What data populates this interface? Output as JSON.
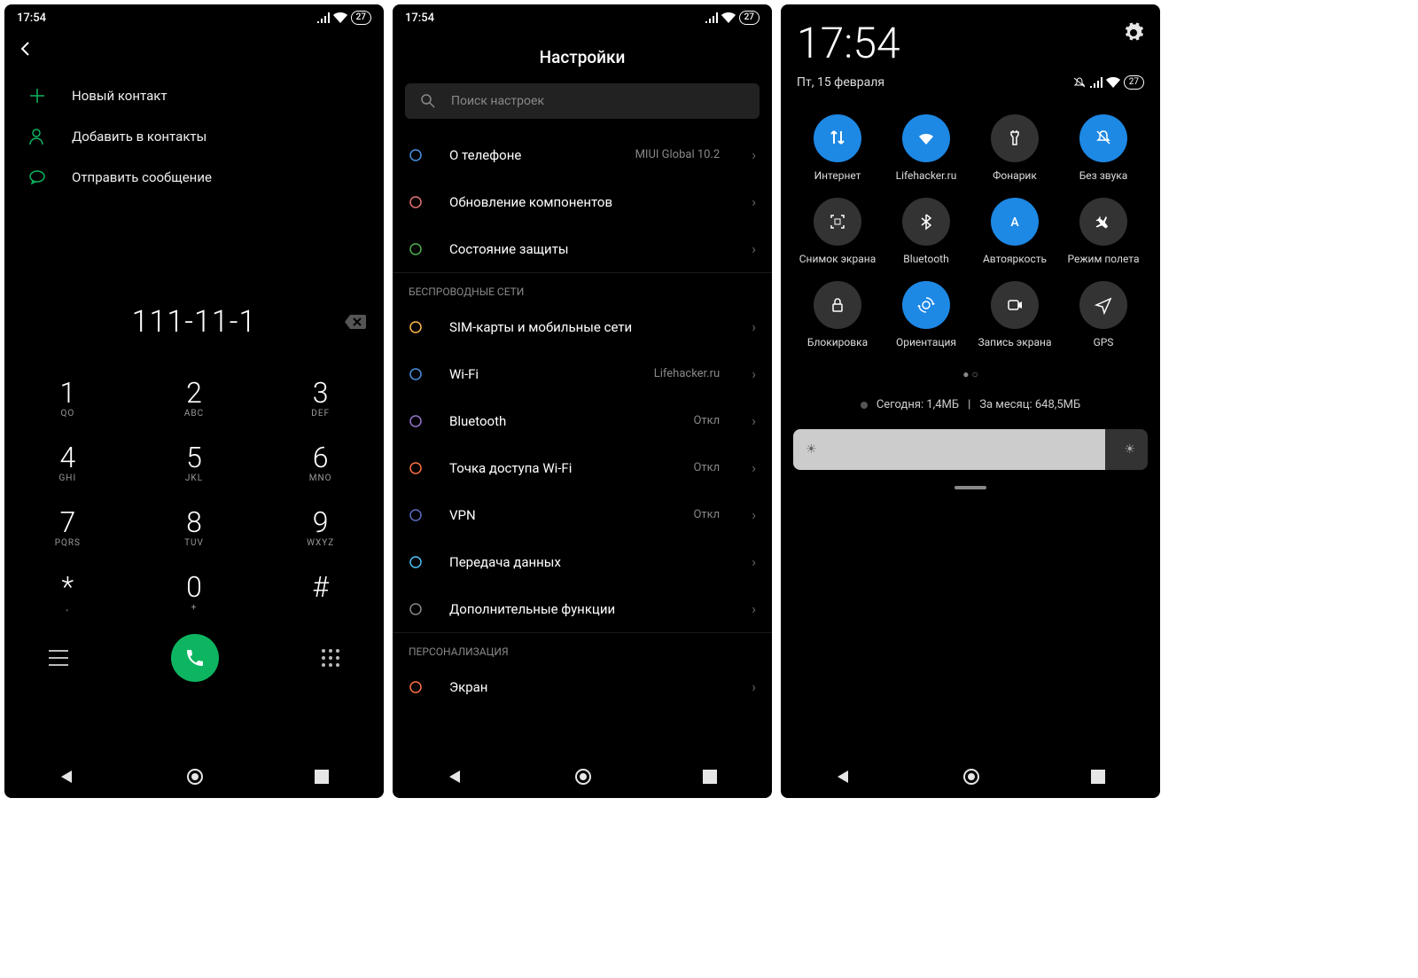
{
  "status": {
    "time": "17:54",
    "battery": "27"
  },
  "dialer": {
    "actions": [
      {
        "label": "Новый контакт",
        "icon": "plus",
        "color": "#0db561"
      },
      {
        "label": "Добавить в контакты",
        "icon": "person",
        "color": "#0db561"
      },
      {
        "label": "Отправить сообщение",
        "icon": "message",
        "color": "#0db561"
      }
    ],
    "number": "111-11-1",
    "keys": [
      [
        {
          "d": "1",
          "l": "QO"
        },
        {
          "d": "2",
          "l": "ABC"
        },
        {
          "d": "3",
          "l": "DEF"
        }
      ],
      [
        {
          "d": "4",
          "l": "GHI"
        },
        {
          "d": "5",
          "l": "JKL"
        },
        {
          "d": "6",
          "l": "MNO"
        }
      ],
      [
        {
          "d": "7",
          "l": "PQRS"
        },
        {
          "d": "8",
          "l": "TUV"
        },
        {
          "d": "9",
          "l": "WXYZ"
        }
      ],
      [
        {
          "d": "*",
          "l": ","
        },
        {
          "d": "0",
          "l": "+"
        },
        {
          "d": "#",
          "l": ""
        }
      ]
    ]
  },
  "settings": {
    "title": "Настройки",
    "search_placeholder": "Поиск настроек",
    "top_items": [
      {
        "label": "О телефоне",
        "value": "MIUI Global 10.2",
        "color": "#4a90e2"
      },
      {
        "label": "Обновление компонентов",
        "value": "",
        "color": "#e57373"
      },
      {
        "label": "Состояние защиты",
        "value": "",
        "color": "#4caf50"
      }
    ],
    "section1_title": "БЕСПРОВОДНЫЕ СЕТИ",
    "section1_items": [
      {
        "label": "SIM-карты и мобильные сети",
        "value": "",
        "color": "#ffb74d"
      },
      {
        "label": "Wi-Fi",
        "value": "Lifehacker.ru",
        "color": "#4a90e2"
      },
      {
        "label": "Bluetooth",
        "value": "Откл",
        "color": "#9575cd"
      },
      {
        "label": "Точка доступа Wi-Fi",
        "value": "Откл",
        "color": "#ff7043"
      },
      {
        "label": "VPN",
        "value": "Откл",
        "color": "#5c6bc0"
      },
      {
        "label": "Передача данных",
        "value": "",
        "color": "#4fc3f7"
      },
      {
        "label": "Дополнительные функции",
        "value": "",
        "color": "#888"
      }
    ],
    "section2_title": "ПЕРСОНАЛИЗАЦИЯ",
    "section2_items": [
      {
        "label": "Экран",
        "value": "",
        "color": "#ff7043"
      }
    ]
  },
  "qs": {
    "time": "17:54",
    "date": "Пт, 15 февраля",
    "tiles": [
      {
        "label": "Интернет",
        "on": true,
        "icon": "data"
      },
      {
        "label": "Lifehacker.ru",
        "on": true,
        "icon": "wifi"
      },
      {
        "label": "Фонарик",
        "on": false,
        "icon": "torch"
      },
      {
        "label": "Без звука",
        "on": true,
        "icon": "mute"
      },
      {
        "label": "Снимок экрана",
        "on": false,
        "icon": "screenshot"
      },
      {
        "label": "Bluetooth",
        "on": false,
        "icon": "bt"
      },
      {
        "label": "Автояркость",
        "on": true,
        "icon": "auto"
      },
      {
        "label": "Режим полета",
        "on": false,
        "icon": "plane"
      },
      {
        "label": "Блокировка",
        "on": false,
        "icon": "lock"
      },
      {
        "label": "Ориентация",
        "on": true,
        "icon": "rotate"
      },
      {
        "label": "Запись экрана",
        "on": false,
        "icon": "record"
      },
      {
        "label": "GPS",
        "on": false,
        "icon": "gps"
      }
    ],
    "data_today_label": "Сегодня:",
    "data_today": "1,4МБ",
    "data_month_label": "За месяц:",
    "data_month": "648,5МБ"
  }
}
